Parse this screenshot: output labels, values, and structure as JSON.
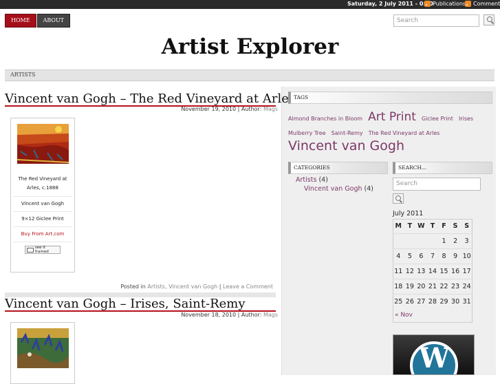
{
  "topbar": {
    "date": "Saturday, 2 July 2011 - 0:10",
    "publications": "Publications",
    "comments": "Comments"
  },
  "nav": {
    "home": "HOME",
    "about": "ABOUT"
  },
  "search_top": {
    "placeholder": "Search"
  },
  "site_title": "Artist Explorer",
  "catbar": {
    "artists": "ARTISTS"
  },
  "posts": [
    {
      "title": "Vincent van Gogh – The Red Vineyard at Arles",
      "date": "November 19, 2010",
      "author_label": "| Author:",
      "author": "Mags",
      "card": {
        "title_line1": "The Red Vineyard at",
        "title_line2": "Arles, c.1888",
        "artist": "Vincent van Gogh",
        "size": "9×12 Giclee Print",
        "buy": "Buy From Art.com",
        "framed": "see it framed"
      },
      "posted_in": "Posted in",
      "cat1": "Artists,",
      "cat2": "Vincent van Gogh",
      "sep": "|",
      "leave": "Leave a Comment"
    },
    {
      "title": "Vincent van Gogh – Irises, Saint-Remy",
      "date": "November 18, 2010",
      "author_label": "| Author:",
      "author": "Mags"
    }
  ],
  "sidebar": {
    "tags_title": "TAGS",
    "tags": [
      {
        "label": "Almond Branches in Bloom",
        "size": 8
      },
      {
        "label": "Art Print",
        "size": 17
      },
      {
        "label": "Giclee Print",
        "size": 8
      },
      {
        "label": "Irises",
        "size": 8
      },
      {
        "label": "Mulberry Tree",
        "size": 8
      },
      {
        "label": "Saint-Remy",
        "size": 8
      },
      {
        "label": "The Red Vineyard at Arles",
        "size": 8
      },
      {
        "label": "Vincent van Gogh",
        "size": 19
      }
    ],
    "categories_title": "CATEGORIES",
    "categories": [
      {
        "label": "Artists",
        "count": "(4)"
      },
      {
        "label": "Vincent van Gogh",
        "count": "(4)"
      }
    ],
    "search_title": "SEARCH...",
    "search_placeholder": "Search",
    "calendar": {
      "caption": "July 2011",
      "days": [
        "M",
        "T",
        "W",
        "T",
        "F",
        "S",
        "S"
      ],
      "weeks": [
        [
          "",
          "",
          "",
          "",
          "1",
          "2",
          "3"
        ],
        [
          "4",
          "5",
          "6",
          "7",
          "8",
          "9",
          "10"
        ],
        [
          "11",
          "12",
          "13",
          "14",
          "15",
          "16",
          "17"
        ],
        [
          "18",
          "19",
          "20",
          "21",
          "22",
          "23",
          "24"
        ],
        [
          "25",
          "26",
          "27",
          "28",
          "29",
          "30",
          "31"
        ]
      ],
      "prev": "« Nov"
    },
    "wp_logo": "W"
  },
  "colors": {
    "accent": "#b5111d",
    "link": "#7b3866",
    "topbar": "#2b2b2b"
  }
}
